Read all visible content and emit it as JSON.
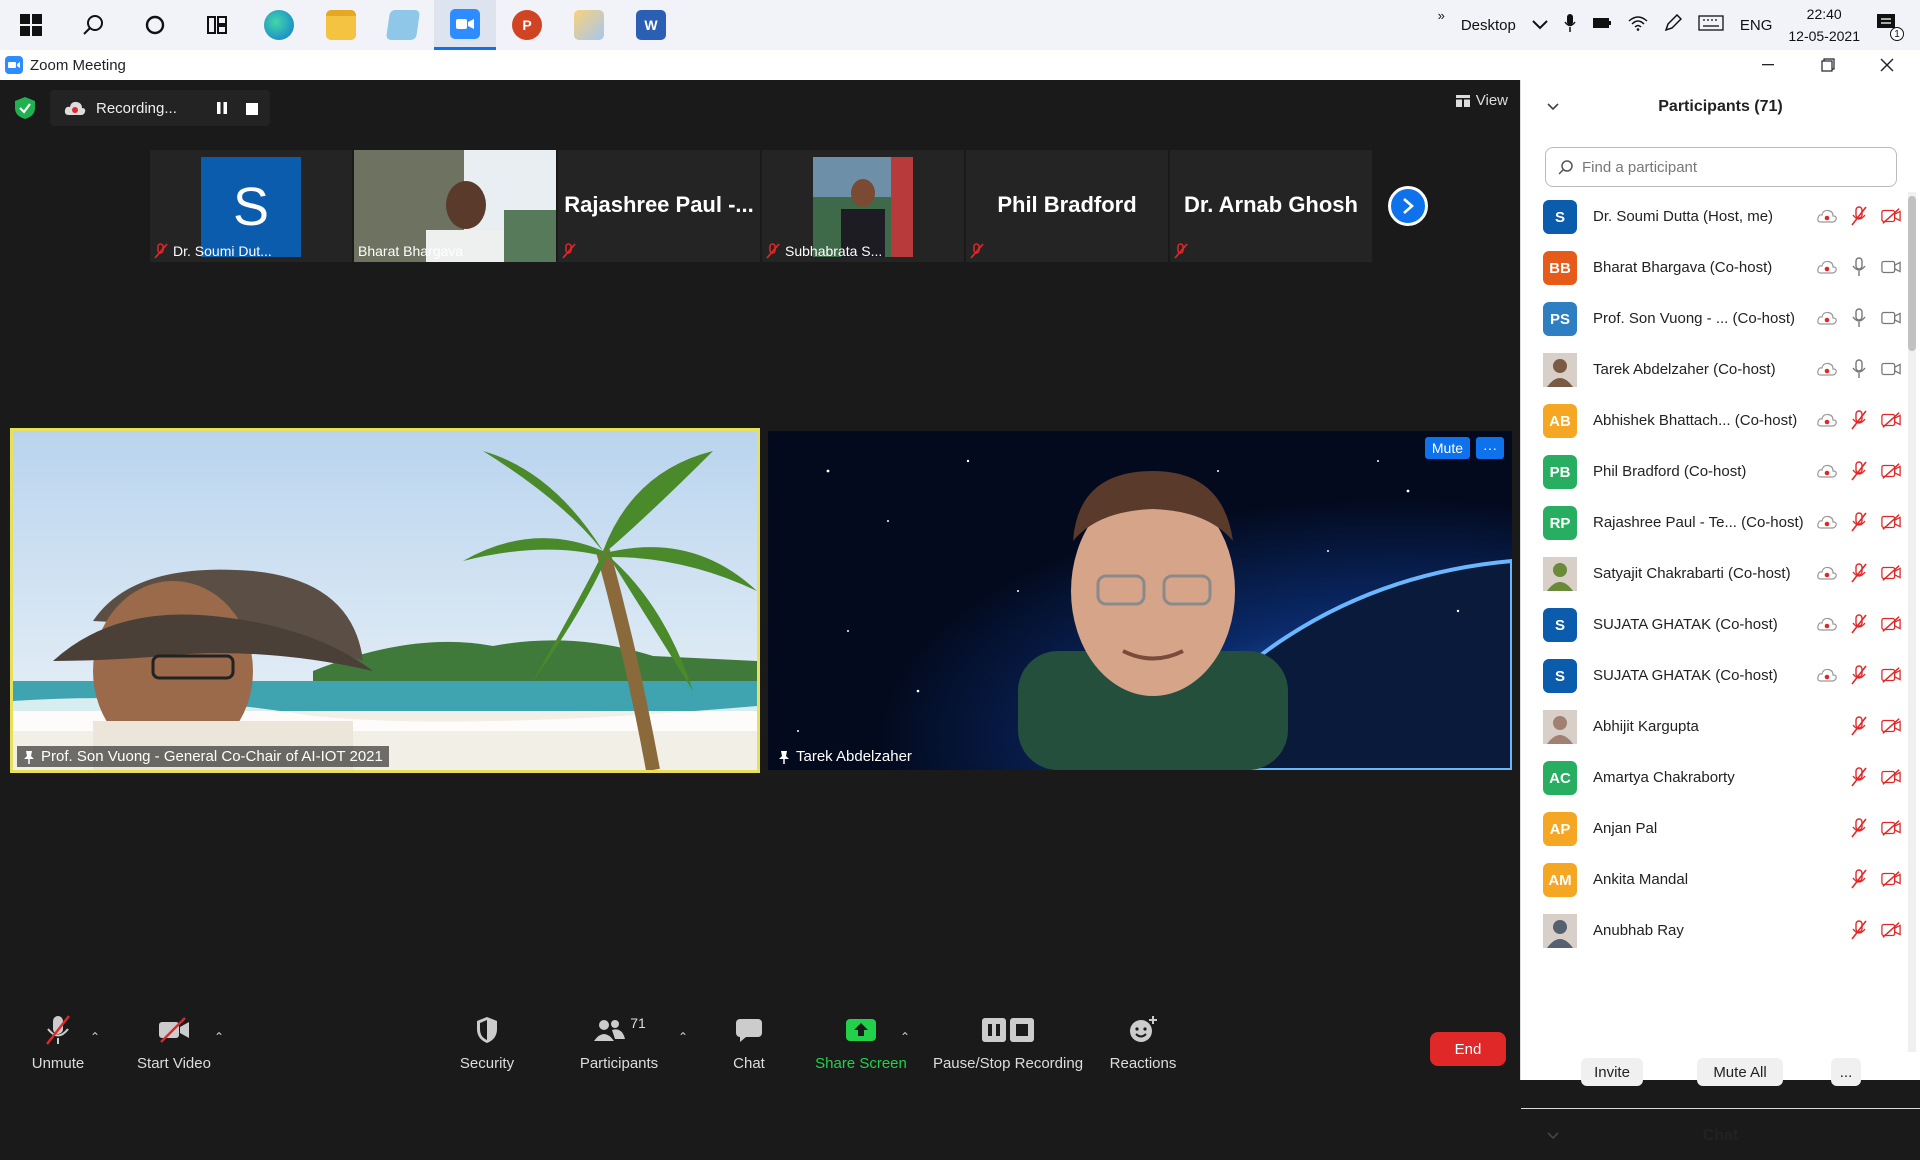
{
  "taskbar": {
    "desktop_label": "Desktop",
    "lang": "ENG",
    "time": "22:40",
    "date": "12-05-2021",
    "notif_count": "1",
    "more": "»"
  },
  "window": {
    "title": "Zoom Meeting"
  },
  "meeting": {
    "recording_label": "Recording...",
    "view_label": "View",
    "thumbs": [
      {
        "label": "Dr. Soumi Dut...",
        "avatar_letter": "S",
        "avatar_color": "#0b5cad"
      },
      {
        "label": "Bharat Bhargava"
      },
      {
        "big_name": "Rajashree  Paul  -..."
      },
      {
        "label": "Subhabrata S..."
      },
      {
        "big_name": "Phil Bradford"
      },
      {
        "big_name": "Dr. Arnab Ghosh"
      }
    ],
    "tiles": [
      {
        "name": "Prof. Son Vuong - General Co-Chair of AI-IOT 2021"
      },
      {
        "name": "Tarek Abdelzaher",
        "mute_label": "Mute",
        "more_label": "···"
      }
    ]
  },
  "toolbar": {
    "unmute": "Unmute",
    "start_video": "Start Video",
    "security": "Security",
    "participants": "Participants",
    "participants_count": "71",
    "chat": "Chat",
    "share_screen": "Share Screen",
    "pause_stop_recording": "Pause/Stop Recording",
    "reactions": "Reactions",
    "end": "End"
  },
  "panel": {
    "title": "Participants (71)",
    "search_placeholder": "Find a participant",
    "invite": "Invite",
    "mute_all": "Mute All",
    "more": "...",
    "chat_title": "Chat",
    "participants": [
      {
        "name": "Dr. Soumi Dutta (Host, me)",
        "initials": "S",
        "color": "#0b5cad",
        "mic": "off",
        "video": "off",
        "rec": true
      },
      {
        "name": "Bharat Bhargava (Co-host)",
        "initials": "BB",
        "color": "#e65a1a",
        "mic": "on",
        "video": "on",
        "rec": true
      },
      {
        "name": "Prof. Son Vuong - ...  (Co-host)",
        "initials": "PS",
        "color": "#2d7fc1",
        "mic": "on",
        "video": "on",
        "rec": true
      },
      {
        "name": "Tarek Abdelzaher (Co-host)",
        "initials": "",
        "color": "#7a5a44",
        "mic": "on",
        "video": "on",
        "rec": true
      },
      {
        "name": "Abhishek Bhattach...  (Co-host)",
        "initials": "AB",
        "color": "#f5a623",
        "mic": "off",
        "video": "off",
        "rec": true
      },
      {
        "name": "Phil Bradford (Co-host)",
        "initials": "PB",
        "color": "#27ae60",
        "mic": "off",
        "video": "off",
        "rec": true
      },
      {
        "name": "Rajashree Paul - Te...  (Co-host)",
        "initials": "RP",
        "color": "#27ae60",
        "mic": "off",
        "video": "off",
        "rec": true
      },
      {
        "name": "Satyajit Chakrabarti (Co-host)",
        "initials": "",
        "color": "#6a8a3a",
        "mic": "off",
        "video": "off",
        "rec": true
      },
      {
        "name": "SUJATA GHATAK (Co-host)",
        "initials": "S",
        "color": "#0b5cad",
        "mic": "off",
        "video": "off",
        "rec": true
      },
      {
        "name": "SUJATA GHATAK (Co-host)",
        "initials": "S",
        "color": "#0b5cad",
        "mic": "off",
        "video": "off",
        "rec": true
      },
      {
        "name": "Abhijit Kargupta",
        "initials": "",
        "color": "#a08070",
        "mic": "off",
        "video": "off",
        "rec": false
      },
      {
        "name": "Amartya Chakraborty",
        "initials": "AC",
        "color": "#27ae60",
        "mic": "off",
        "video": "off",
        "rec": false
      },
      {
        "name": "Anjan Pal",
        "initials": "AP",
        "color": "#f5a623",
        "mic": "off",
        "video": "off",
        "rec": false
      },
      {
        "name": "Ankita Mandal",
        "initials": "AM",
        "color": "#f5a623",
        "mic": "off",
        "video": "off",
        "rec": false
      },
      {
        "name": "Anubhab Ray",
        "initials": "",
        "color": "#556070",
        "mic": "off",
        "video": "off",
        "rec": false
      }
    ]
  }
}
